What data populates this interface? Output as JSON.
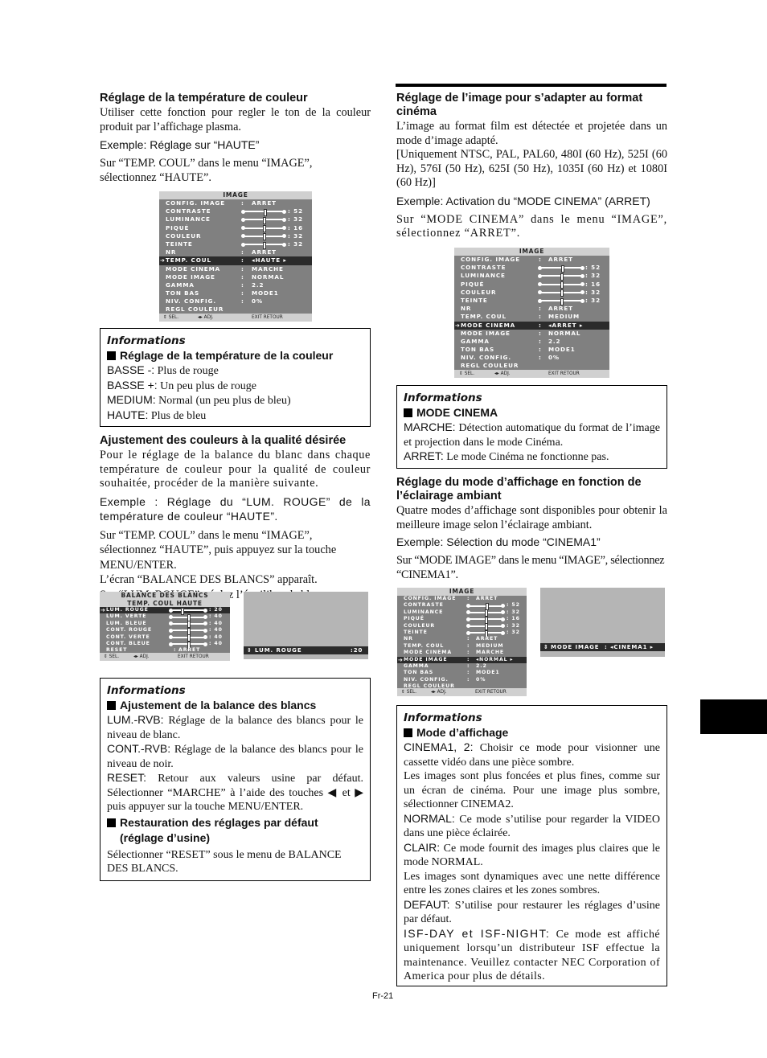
{
  "page_number": "Fr-21",
  "left_column": {
    "s1": {
      "heading": "Réglage de la température de couleur",
      "intro": "Utiliser cette fonction pour regler le ton de la couleur produit par l’affichage plasma.",
      "example": "Exemple: Réglage sur “HAUTE”",
      "instruction": "Sur “TEMP. COUL” dans le menu “IMAGE”, sélectionnez “HAUTE”."
    },
    "menu1": {
      "title": "IMAGE",
      "rows": [
        {
          "label": "CONFIG. IMAGE",
          "value": "ARRET"
        },
        {
          "label": "CONTRASTE",
          "value": "52",
          "bar": 0.52
        },
        {
          "label": "LUMINANCE",
          "value": "32",
          "bar": 0.5
        },
        {
          "label": "PIQUÉ",
          "value": "16",
          "bar": 0.5
        },
        {
          "label": "COULEUR",
          "value": "32",
          "bar": 0.5
        },
        {
          "label": "TEINTE",
          "value": "32",
          "bar": 0.5
        },
        {
          "label": "NR",
          "value": "ARRET"
        },
        {
          "label": "TEMP. COUL",
          "value": "◂HAUTE ▸",
          "selected": true
        },
        {
          "label": "MODE CINEMA",
          "value": "MARCHE"
        },
        {
          "label": "MODE IMAGE",
          "value": "NORMAL"
        },
        {
          "label": "GAMMA",
          "value": "2.2"
        },
        {
          "label": "TON BAS",
          "value": "MODE1"
        },
        {
          "label": "NIV. CONFIG.",
          "value": "0%"
        },
        {
          "label": "REGL COULEUR",
          "value": ""
        }
      ],
      "footer": {
        "sel": "⇕ SEL.",
        "adj": "◂▸ ADJ.",
        "ret": "EXIT RETOUR"
      }
    },
    "info1": {
      "title": "Informations",
      "subtitle": "Réglage de la température de la couleur",
      "lines": [
        {
          "key": "BASSE -:",
          "text": " Plus de rouge"
        },
        {
          "key": "BASSE +:",
          "text": " Un peu plus de rouge"
        },
        {
          "key": "MEDIUM:",
          "text": " Normal (un peu plus de bleu)"
        },
        {
          "key": "HAUTE:",
          "text": " Plus de bleu"
        }
      ]
    },
    "s2": {
      "heading": "Ajustement des couleurs à la qualité désirée",
      "intro": "Pour le réglage de la balance du blanc dans chaque température de couleur pour la qualité de couleur souhaitée, procéder de la manière suivante.",
      "example": "Exemple : Réglage du “LUM. ROUGE” de la température de couleur “HAUTE”.",
      "instruction1": "Sur “TEMP. COUL” dans le menu “IMAGE”, sélectionnez “HAUTE”, puis appuyez sur la touche MENU/ENTER.",
      "instruction2": "L’écran “BALANCE DES BLANCS” apparaît.",
      "instruction3": "Sur “LUM. ROUGE”, réglez l’équilibre de blanc."
    },
    "menu_balance": {
      "title1": "BALANCE DES BLANCS",
      "title2": "TEMP. COUL HAUTE",
      "rows": [
        {
          "label": "LUM. ROUGE",
          "value": "20",
          "bar": 0.3,
          "selected": true
        },
        {
          "label": "LUM. VERTE",
          "value": "40",
          "bar": 0.5
        },
        {
          "label": "LUM. BLEUE",
          "value": "40",
          "bar": 0.5
        },
        {
          "label": "CONT. ROUGE",
          "value": "40",
          "bar": 0.5
        },
        {
          "label": "CONT. VERTE",
          "value": "40",
          "bar": 0.5
        },
        {
          "label": "CONT. BLEUE",
          "value": "40",
          "bar": 0.5
        },
        {
          "label": "RESET",
          "value": "ARRET"
        }
      ],
      "footer": {
        "sel": "⇕ SEL.",
        "adj": "◂▸ ADJ.",
        "ret": "EXIT RETOUR"
      }
    },
    "screen_lum": {
      "label": "LUM. ROUGE",
      "value": "20",
      "bar": 0.3
    },
    "info2": {
      "title": "Informations",
      "subtitle1": "Ajustement de la balance des blancs",
      "lines": [
        {
          "key": "LUM.-RVB:",
          "text": " Réglage de la balance des blancs pour le niveau de blanc."
        },
        {
          "key": "CONT.-RVB:",
          "text": " Réglage de la balance des blancs pour le niveau de noir."
        },
        {
          "key": "RESET:",
          "text": " Retour aux valeurs usine par défaut. Sélectionner “MARCHE” à l’aide des touches ◀ et ▶ puis appuyer sur la touche MENU/ENTER."
        }
      ],
      "subtitle2a": "Restauration des réglages par défaut",
      "subtitle2b": "(réglage d’usine)",
      "final": "Sélectionner “RESET” sous le menu de BALANCE DES BLANCS."
    }
  },
  "right_column": {
    "s3": {
      "heading": "Réglage de l’image pour s’adapter au format cinéma",
      "intro": "L’image au format film est détectée et projetée dans un mode d’image adapté.",
      "formats": "[Uniquement NTSC, PAL, PAL60, 480I (60 Hz), 525I (60 Hz), 576I (50 Hz), 625I (50 Hz), 1035I (60 Hz) et 1080I (60 Hz)]",
      "example": "Exemple: Activation du “MODE CINEMA” (ARRET)",
      "instruction": "Sur “MODE CINEMA” dans le menu “IMAGE”, sélectionnez “ARRET”."
    },
    "menu2": {
      "title": "IMAGE",
      "rows": [
        {
          "label": "CONFIG. IMAGE",
          "value": "ARRET"
        },
        {
          "label": "CONTRASTE",
          "value": "52",
          "bar": 0.52
        },
        {
          "label": "LUMINANCE",
          "value": "32",
          "bar": 0.5
        },
        {
          "label": "PIQUÉ",
          "value": "16",
          "bar": 0.5
        },
        {
          "label": "COULEUR",
          "value": "32",
          "bar": 0.5
        },
        {
          "label": "TEINTE",
          "value": "32",
          "bar": 0.5
        },
        {
          "label": "NR",
          "value": "ARRET"
        },
        {
          "label": "TEMP. COUL",
          "value": "MEDIUM"
        },
        {
          "label": "MODE CINEMA",
          "value": "◂ARRET ▸",
          "selected": true
        },
        {
          "label": "MODE IMAGE",
          "value": "NORMAL"
        },
        {
          "label": "GAMMA",
          "value": "2.2"
        },
        {
          "label": "TON BAS",
          "value": "MODE1"
        },
        {
          "label": "NIV. CONFIG.",
          "value": "0%"
        },
        {
          "label": "REGL COULEUR",
          "value": ""
        }
      ],
      "footer": {
        "sel": "⇕ SEL.",
        "adj": "◂▸ ADJ.",
        "ret": "EXIT RETOUR"
      }
    },
    "info3": {
      "title": "Informations",
      "subtitle": "MODE CINEMA",
      "lines": [
        {
          "key": "MARCHE:",
          "text": " Détection automatique du format de l’image et projection dans le mode Cinéma."
        },
        {
          "key": "ARRET:",
          "text": " Le mode Cinéma ne fonctionne pas."
        }
      ]
    },
    "s4": {
      "heading": "Réglage du mode d’affichage en fonction de l’éclairage ambiant",
      "intro": "Quatre modes d’affichage sont disponibles pour obtenir la meilleure image selon l’éclairage ambiant.",
      "example": "Exemple: Sélection du mode “CINEMA1”",
      "instruction": "Sur “MODE IMAGE” dans le menu “IMAGE”, sélectionnez “CINEMA1”."
    },
    "menu3": {
      "title": "IMAGE",
      "rows": [
        {
          "label": "CONFIG. IMAGE",
          "value": "ARRET"
        },
        {
          "label": "CONTRASTE",
          "value": "52",
          "bar": 0.52
        },
        {
          "label": "LUMINANCE",
          "value": "32",
          "bar": 0.5
        },
        {
          "label": "PIQUÉ",
          "value": "16",
          "bar": 0.5
        },
        {
          "label": "COULEUR",
          "value": "32",
          "bar": 0.5
        },
        {
          "label": "TEINTE",
          "value": "32",
          "bar": 0.5
        },
        {
          "label": "NR",
          "value": "ARRET"
        },
        {
          "label": "TEMP. COUL",
          "value": "MEDIUM"
        },
        {
          "label": "MODE CINEMA",
          "value": "MARCHE"
        },
        {
          "label": "MODE IMAGE",
          "value": "◂NORMAL ▸",
          "selected": true
        },
        {
          "label": "GAMMA",
          "value": "2.2"
        },
        {
          "label": "TON BAS",
          "value": "MODE1"
        },
        {
          "label": "NIV. CONFIG.",
          "value": "0%"
        },
        {
          "label": "REGL COULEUR",
          "value": ""
        }
      ],
      "footer": {
        "sel": "⇕ SEL.",
        "adj": "◂▸ ADJ.",
        "ret": "EXIT RETOUR"
      }
    },
    "screen_mode": {
      "label": "MODE IMAGE",
      "value": "◂CINEMA1 ▸"
    },
    "info4": {
      "title": "Informations",
      "subtitle": "Mode d’affichage",
      "lines": [
        {
          "key": "CINEMA1, 2:",
          "text": " Choisir ce mode pour visionner une cassette vidéo dans une pièce sombre."
        },
        {
          "key": "",
          "text": "Les images sont plus foncées et plus fines, comme sur un écran de cinéma. Pour une image plus sombre, sélectionner CINEMA2."
        },
        {
          "key": "NORMAL:",
          "text": " Ce mode s’utilise pour regarder la VIDEO dans une pièce éclairée."
        },
        {
          "key": "CLAIR:",
          "text": " Ce mode fournit des images plus claires que le mode NORMAL."
        },
        {
          "key": "",
          "text": "Les images sont dynamiques avec une nette différence entre les zones claires et les zones sombres."
        },
        {
          "key": "DEFAUT:",
          "text": " S’utilise pour restaurer les réglages d’usine par défaut."
        },
        {
          "key": "ISF-DAY et ISF-NIGHT:",
          "text": " Ce mode est affiché uniquement lorsqu’un distributeur ISF effectue la maintenance. Veuillez contacter NEC Corporation of America pour plus de détails."
        }
      ]
    }
  }
}
